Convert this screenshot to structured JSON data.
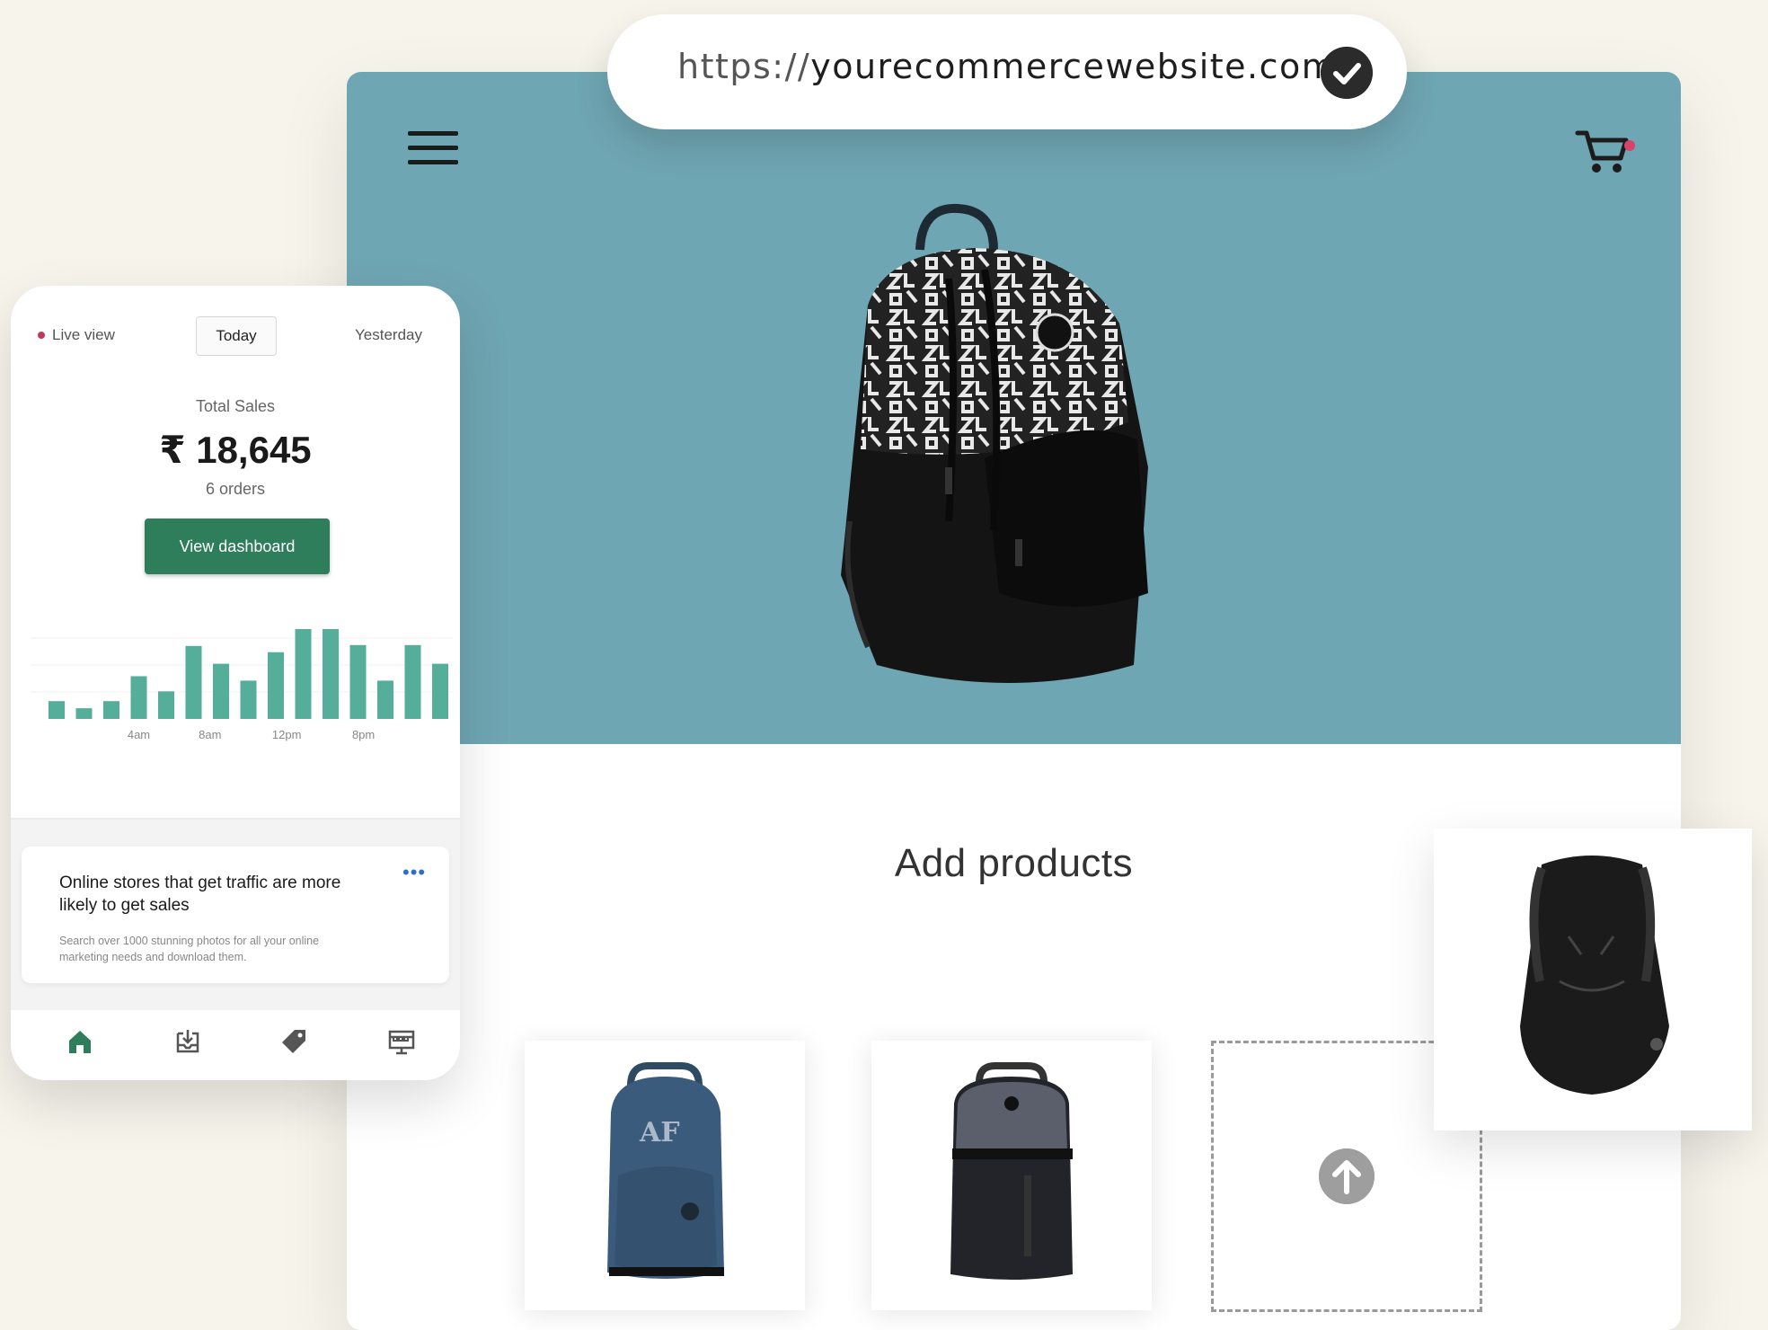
{
  "url": {
    "protocol": "https://",
    "domain": "yourecommercewebsite.com"
  },
  "store": {
    "section_title": "Add products"
  },
  "dashboard": {
    "tabs": {
      "live": "Live view",
      "today": "Today",
      "yesterday": "Yesterday"
    },
    "total_sales_label": "Total Sales",
    "total_sales_value": "₹ 18,645",
    "orders": "6 orders",
    "view_dashboard": "View dashboard",
    "chart_data": {
      "type": "bar",
      "x_tick_labels": [
        "4am",
        "8am",
        "12pm",
        "8pm"
      ],
      "values": [
        2,
        1.2,
        2,
        4.8,
        3.1,
        8.2,
        6.2,
        4.3,
        7.5,
        10.1,
        10.1,
        8.3,
        4.3,
        8.3,
        6.2
      ],
      "color": "#55ae9a"
    },
    "tip": {
      "title": "Online stores that get traffic are more likely to get sales",
      "description": "Search over 1000 stunning photos for all your online marketing needs and download them.",
      "more": "•••"
    },
    "nav": [
      "home-icon",
      "orders-icon",
      "products-icon",
      "online-store-icon"
    ]
  },
  "colors": {
    "hero": "#6fa6b3",
    "accent": "#2e7d5b",
    "background": "#f7f4ec"
  }
}
